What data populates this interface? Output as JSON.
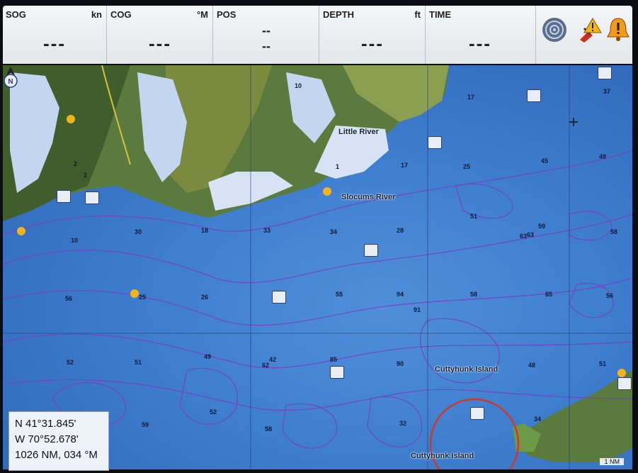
{
  "databar": {
    "sog": {
      "label": "SOG",
      "unit": "kn",
      "value": "---"
    },
    "cog": {
      "label": "COG",
      "unit": "°M",
      "value": "---"
    },
    "pos": {
      "label": "POS",
      "line1": "--",
      "line2": "--"
    },
    "depth": {
      "label": "DEPTH",
      "unit": "ft",
      "value": "---"
    },
    "time": {
      "label": "TIME",
      "value": "---"
    },
    "icons": [
      "radar-icon",
      "alarm-warning-icon",
      "alarm-bell-icon"
    ]
  },
  "map": {
    "places": [
      "Little River",
      "Slocums River",
      "Cuttyhunk Island",
      "Cuttyhunk Island"
    ],
    "depths": [
      "10",
      "17",
      "15",
      "37",
      "2",
      "1",
      "2",
      "17",
      "25",
      "49",
      "45",
      "51",
      "63",
      "59",
      "58",
      "10",
      "34",
      "28",
      "30",
      "33",
      "63",
      "56",
      "25",
      "26",
      "55",
      "94",
      "58",
      "65",
      "56",
      "91",
      "85",
      "52",
      "51",
      "49",
      "42",
      "62",
      "90",
      "48",
      "51",
      "59",
      "52",
      "58",
      "32",
      "34",
      "18"
    ]
  },
  "cursor": {
    "lat": "N  41°31.845'",
    "lon": "W  70°52.678'",
    "range": "1026 NM, 034 °M"
  },
  "scale_label": "1 NM",
  "colors": {
    "water": "#3f7fcf",
    "land": "#5b7a3e",
    "contour": "#7b3fc0",
    "cursor": "#d0382b"
  }
}
